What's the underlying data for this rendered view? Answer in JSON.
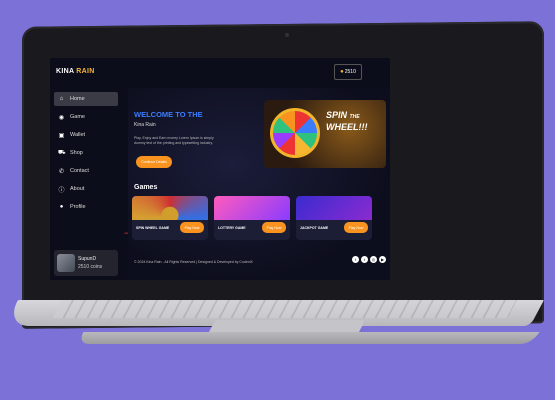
{
  "app": {
    "logo_main": "KINA",
    "logo_accent": " RAIN"
  },
  "header": {
    "coins_icon": "coin-icon",
    "coins_value": "2510"
  },
  "sidebar": {
    "items": [
      {
        "label": "Home",
        "icon": "home-icon",
        "glyph": "⌂"
      },
      {
        "label": "Game",
        "icon": "gamepad-icon",
        "glyph": "◉"
      },
      {
        "label": "Wallet",
        "icon": "wallet-icon",
        "glyph": "▣"
      },
      {
        "label": "Shop",
        "icon": "cart-icon",
        "glyph": "⛟"
      },
      {
        "label": "Contact",
        "icon": "phone-icon",
        "glyph": "✆"
      },
      {
        "label": "About",
        "icon": "info-icon",
        "glyph": "ⓘ"
      },
      {
        "label": "Profile",
        "icon": "user-icon",
        "glyph": "●"
      }
    ],
    "user": {
      "name": "SupunD",
      "coins": "2510 coins"
    }
  },
  "hero": {
    "title": "WELCOME TO THE",
    "subtitle": "Kina Rain",
    "description": "Play, Enjoy and Earn money Lorem Ipsum is simply dummy text of the printing and typesetting industry.",
    "button": "Continue Details",
    "banner_text_1": "SPIN",
    "banner_text_2": "THE",
    "banner_text_3": "WHEEL!!!"
  },
  "games": {
    "title": "Games",
    "items": [
      {
        "name": "SPIN WHEEL GAME",
        "play": "Play Now"
      },
      {
        "name": "LOTTERY GAME",
        "play": "Play Now"
      },
      {
        "name": "JACKPOT GAME",
        "play": "Play Now"
      }
    ]
  },
  "footer": {
    "text": "© 2024 Kina Rain - All Rights Reserved | Designed & Developed by CodeniX",
    "social": [
      "facebook-icon",
      "twitter-icon",
      "instagram-icon",
      "youtube-icon"
    ]
  },
  "colors": {
    "accent": "#f7931e",
    "title_blue": "#3b7cff",
    "background": "#7b71d6"
  }
}
